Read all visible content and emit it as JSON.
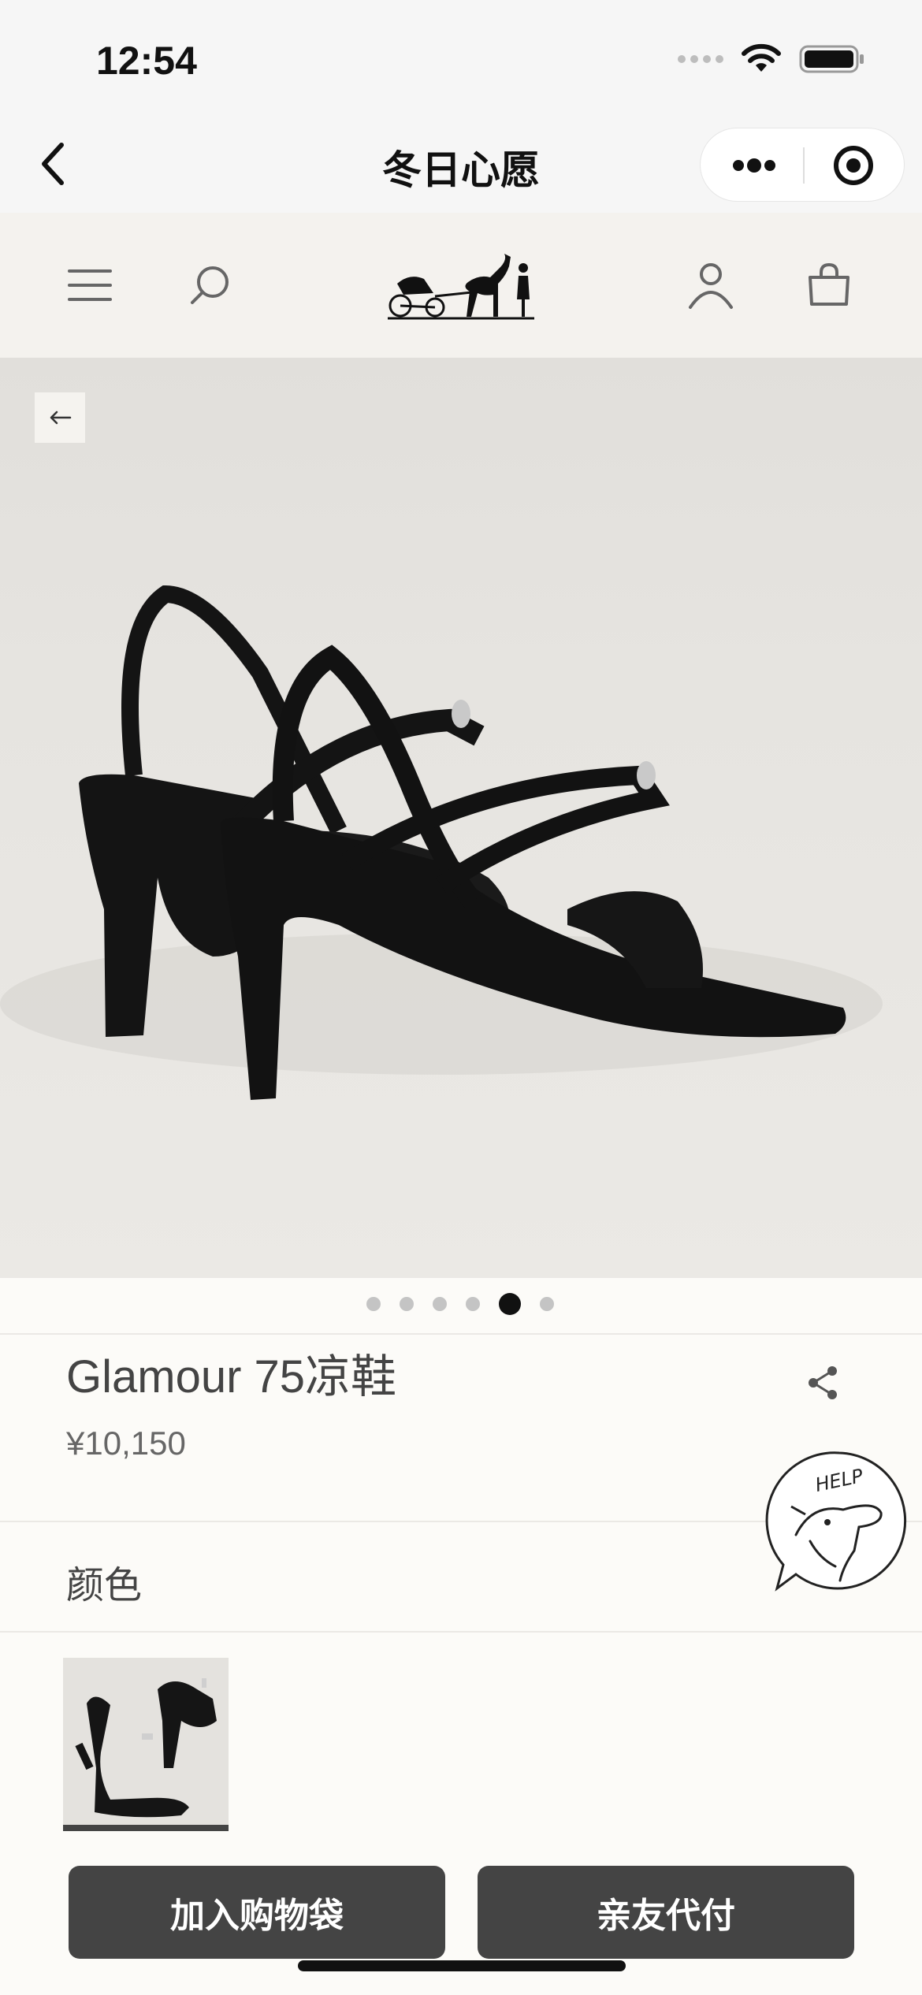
{
  "status_bar": {
    "time": "12:54"
  },
  "mini_program": {
    "title": "冬日心愿"
  },
  "product": {
    "name": "Glamour 75凉鞋",
    "price": "¥10,150",
    "color_label": "颜色",
    "gallery": {
      "total_images": 6,
      "active_index": 4
    }
  },
  "help": {
    "label": "HELP"
  },
  "actions": {
    "add_to_bag": "加入购物袋",
    "friend_pay": "亲友代付"
  },
  "icons": {
    "nav_back": "chevron-left-icon",
    "more": "more-dots-icon",
    "close_target": "target-icon",
    "menu": "hamburger-menu-icon",
    "search": "search-icon",
    "logo": "carriage-logo",
    "account": "user-icon",
    "bag": "shopping-bag-icon",
    "gallery_back": "arrow-left-icon",
    "share": "share-icon"
  },
  "colors": {
    "button": "#444444",
    "background": "#fcfbf8",
    "header": "#f4f2ee"
  }
}
